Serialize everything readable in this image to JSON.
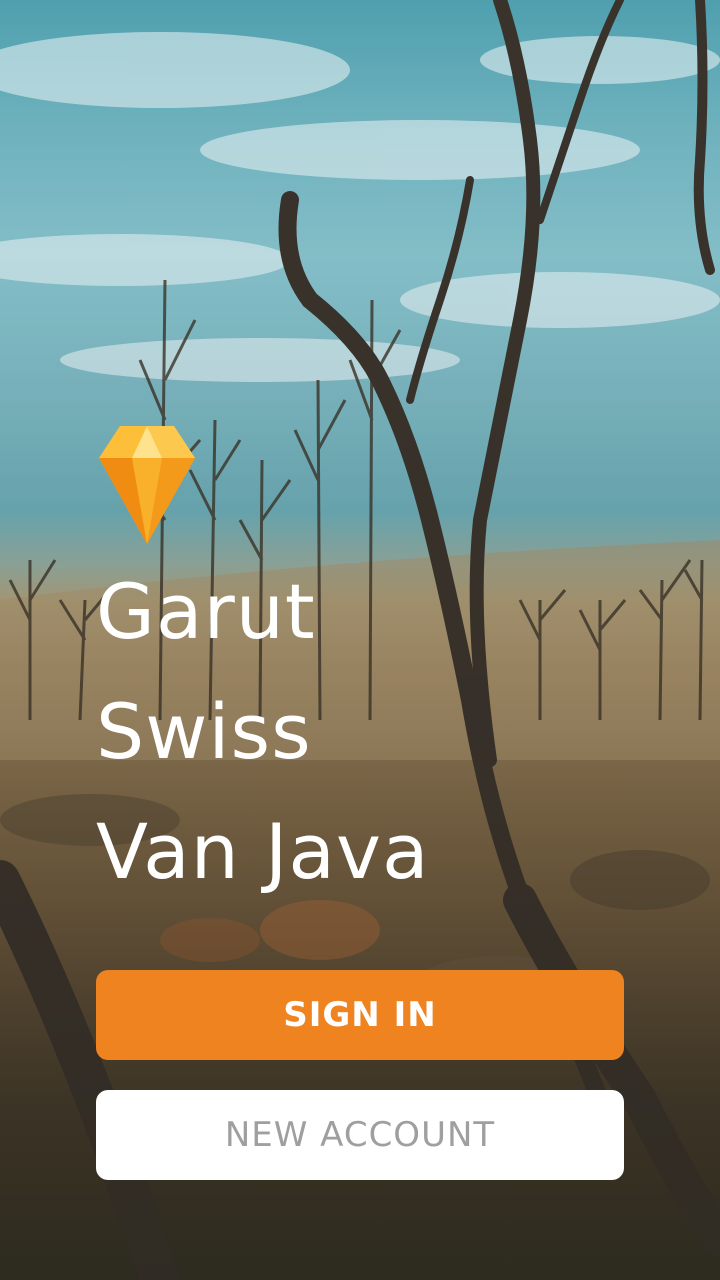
{
  "app": {
    "title_lines": [
      "Garut",
      "Swiss",
      "Van Java"
    ],
    "logo_icon": "sketch-diamond-icon"
  },
  "actions": {
    "sign_in_label": "SIGN IN",
    "new_account_label": "NEW ACCOUNT"
  },
  "colors": {
    "primary": "#EE8320",
    "secondary_bg": "#FFFFFF",
    "secondary_text": "#9F9F9F",
    "title_text": "#FFFFFF"
  }
}
